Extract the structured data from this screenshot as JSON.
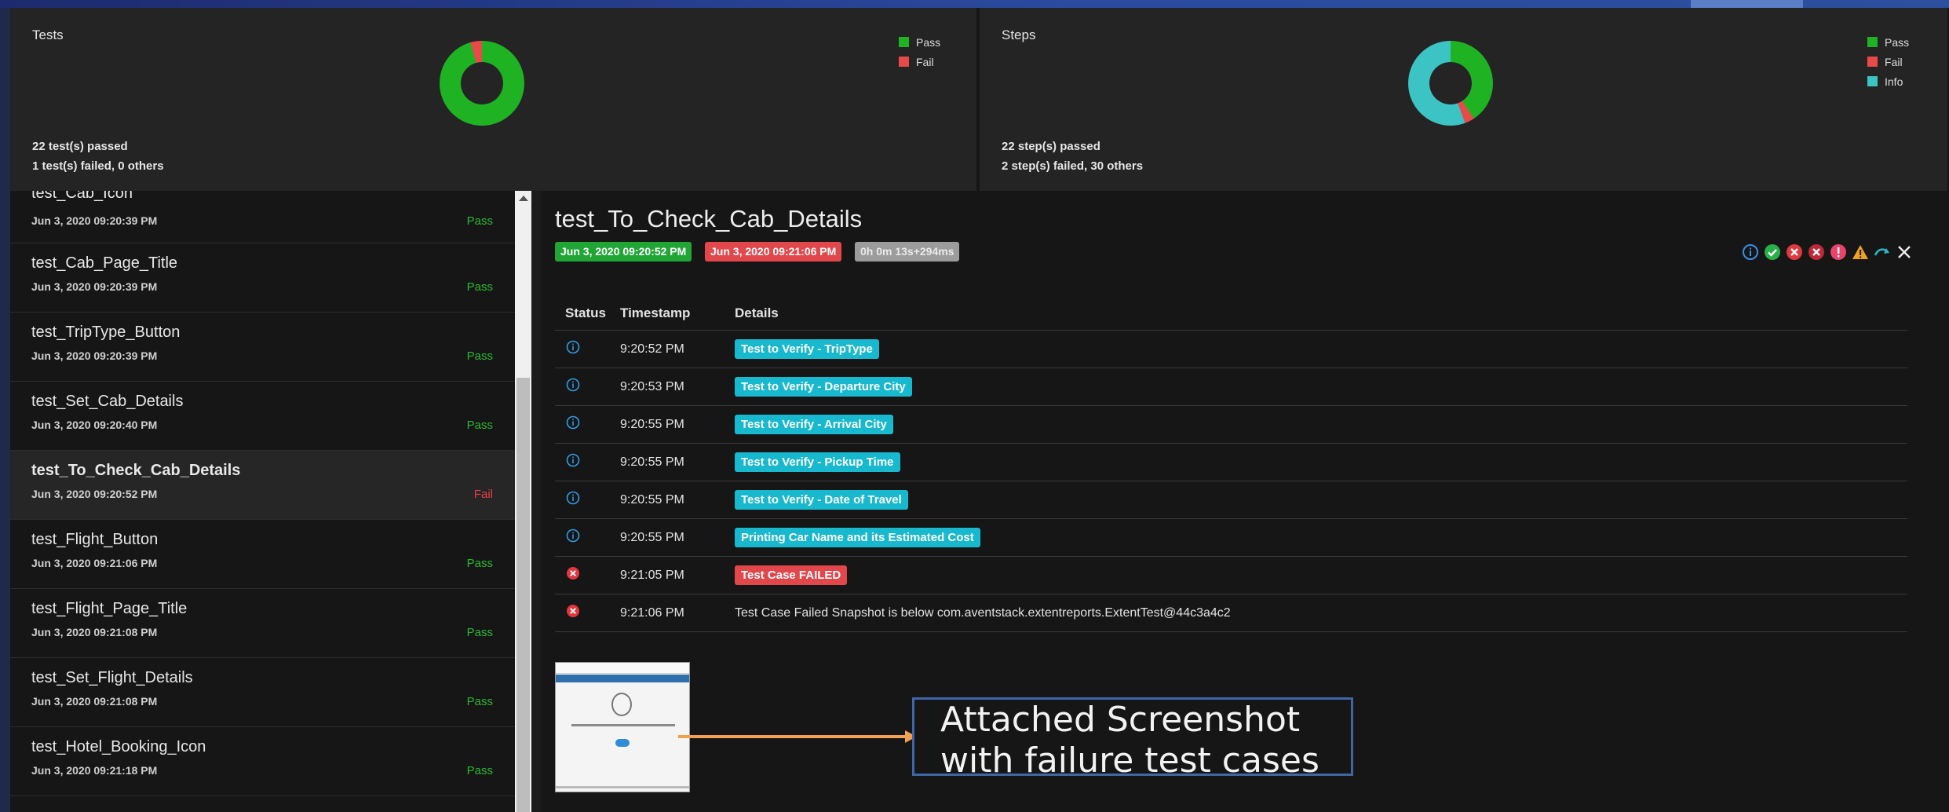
{
  "colors": {
    "pass": "#1fb324",
    "fail": "#e84a4a",
    "info": "#3cc4c4",
    "accent_blue": "#2b4aa0"
  },
  "dashboard": {
    "tests": {
      "title": "Tests",
      "legend": [
        "Pass",
        "Fail"
      ],
      "donut": {
        "pass": 22,
        "fail": 1
      },
      "summary_line1": "22 test(s) passed",
      "summary_line2": "1 test(s) failed, 0 others"
    },
    "steps": {
      "title": "Steps",
      "legend": [
        "Pass",
        "Fail",
        "Info"
      ],
      "donut": {
        "pass": 22,
        "fail": 2,
        "info": 30
      },
      "summary_line1": "22 step(s) passed",
      "summary_line2": "2 step(s) failed, 30 others"
    }
  },
  "tests": [
    {
      "name": "test_Cab_Icon",
      "time": "Jun 3, 2020 09:20:39 PM",
      "status": "Pass"
    },
    {
      "name": "test_Cab_Page_Title",
      "time": "Jun 3, 2020 09:20:39 PM",
      "status": "Pass"
    },
    {
      "name": "test_TripType_Button",
      "time": "Jun 3, 2020 09:20:39 PM",
      "status": "Pass"
    },
    {
      "name": "test_Set_Cab_Details",
      "time": "Jun 3, 2020 09:20:40 PM",
      "status": "Pass"
    },
    {
      "name": "test_To_Check_Cab_Details",
      "time": "Jun 3, 2020 09:20:52 PM",
      "status": "Fail"
    },
    {
      "name": "test_Flight_Button",
      "time": "Jun 3, 2020 09:21:06 PM",
      "status": "Pass"
    },
    {
      "name": "test_Flight_Page_Title",
      "time": "Jun 3, 2020 09:21:08 PM",
      "status": "Pass"
    },
    {
      "name": "test_Set_Flight_Details",
      "time": "Jun 3, 2020 09:21:08 PM",
      "status": "Pass"
    },
    {
      "name": "test_Hotel_Booking_Icon",
      "time": "Jun 3, 2020 09:21:18 PM",
      "status": "Pass"
    }
  ],
  "detail": {
    "title": "test_To_Check_Cab_Details",
    "start": "Jun 3, 2020 09:20:52 PM",
    "end": "Jun 3, 2020 09:21:06 PM",
    "duration": "0h 0m 13s+294ms",
    "filter_icons": [
      "info-icon",
      "pass-icon",
      "fail-icon",
      "fatal-icon",
      "error-icon",
      "warning-icon",
      "skip-icon",
      "clear-filter-icon"
    ],
    "columns": {
      "status": "Status",
      "timestamp": "Timestamp",
      "details": "Details"
    },
    "logs": [
      {
        "status": "info",
        "time": "9:20:52 PM",
        "text": "Test to Verify - TripType",
        "style": "info"
      },
      {
        "status": "info",
        "time": "9:20:53 PM",
        "text": "Test to Verify - Departure City",
        "style": "info"
      },
      {
        "status": "info",
        "time": "9:20:55 PM",
        "text": "Test to Verify - Arrival City",
        "style": "info"
      },
      {
        "status": "info",
        "time": "9:20:55 PM",
        "text": "Test to Verify - Pickup Time",
        "style": "info"
      },
      {
        "status": "info",
        "time": "9:20:55 PM",
        "text": "Test to Verify - Date of Travel",
        "style": "info"
      },
      {
        "status": "info",
        "time": "9:20:55 PM",
        "text": "Printing Car Name and its Estimated Cost",
        "style": "info"
      },
      {
        "status": "fail",
        "time": "9:21:05 PM",
        "text": "Test Case FAILED",
        "style": "fail"
      },
      {
        "status": "fail",
        "time": "9:21:06 PM",
        "text": "Test Case Failed Snapshot is below com.aventstack.extentreports.ExtentTest@44c3a4c2",
        "style": "plain"
      }
    ]
  },
  "callout": {
    "line1": "Attached Screenshot",
    "line2": "with failure test cases"
  }
}
